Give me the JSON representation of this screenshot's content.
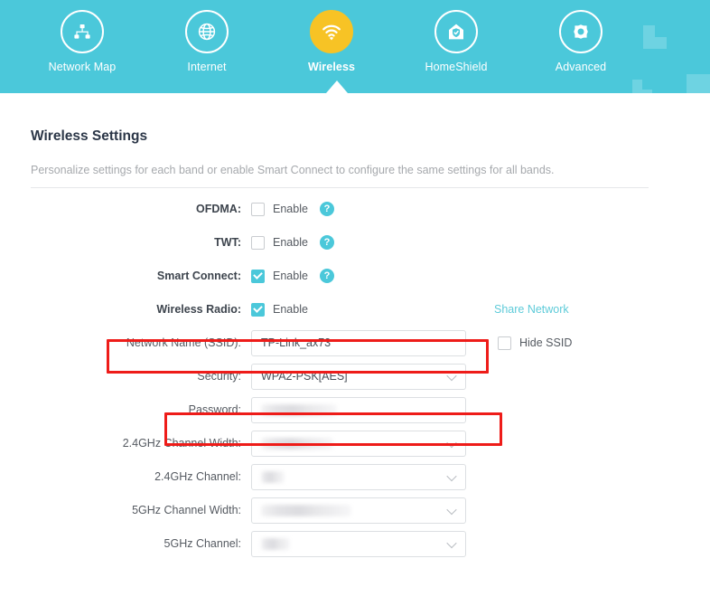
{
  "nav": {
    "items": [
      {
        "label": "Network Map",
        "icon": "network-map-icon",
        "active": false
      },
      {
        "label": "Internet",
        "icon": "globe-icon",
        "active": false
      },
      {
        "label": "Wireless",
        "icon": "wifi-icon",
        "active": true
      },
      {
        "label": "HomeShield",
        "icon": "home-shield-icon",
        "active": false
      },
      {
        "label": "Advanced",
        "icon": "gear-icon",
        "active": false
      }
    ]
  },
  "page": {
    "title": "Wireless Settings",
    "subtitle": "Personalize settings for each band or enable Smart Connect to configure the same settings for all bands."
  },
  "form": {
    "ofdma": {
      "label": "OFDMA:",
      "enable_label": "Enable",
      "checked": false,
      "help": "?"
    },
    "twt": {
      "label": "TWT:",
      "enable_label": "Enable",
      "checked": false,
      "help": "?"
    },
    "smart_connect": {
      "label": "Smart Connect:",
      "enable_label": "Enable",
      "checked": true,
      "help": "?"
    },
    "wireless_radio": {
      "label": "Wireless Radio:",
      "enable_label": "Enable",
      "checked": true
    },
    "share_network": "Share Network",
    "ssid": {
      "label": "Network Name (SSID):",
      "value": "TP-Link_ax73",
      "highlighted": true
    },
    "hide_ssid": {
      "label": "Hide SSID",
      "checked": false
    },
    "security": {
      "label": "Security:",
      "value": "WPA2-PSK[AES]"
    },
    "password": {
      "label": "Password:",
      "value": "",
      "redacted": true,
      "highlighted": true
    },
    "ch_width_24": {
      "label": "2.4GHz Channel Width:",
      "value": "",
      "redacted": true
    },
    "channel_24": {
      "label": "2.4GHz Channel:",
      "value": "",
      "redacted": true
    },
    "ch_width_5": {
      "label": "5GHz Channel Width:",
      "value": "",
      "redacted": true
    },
    "channel_5": {
      "label": "5GHz Channel:",
      "value": "",
      "redacted": true
    }
  },
  "colors": {
    "header_cyan": "#4bc8da",
    "accent_yellow": "#f7c325",
    "highlight_red": "#ee1c19",
    "link_cyan": "#5ecbd9"
  }
}
